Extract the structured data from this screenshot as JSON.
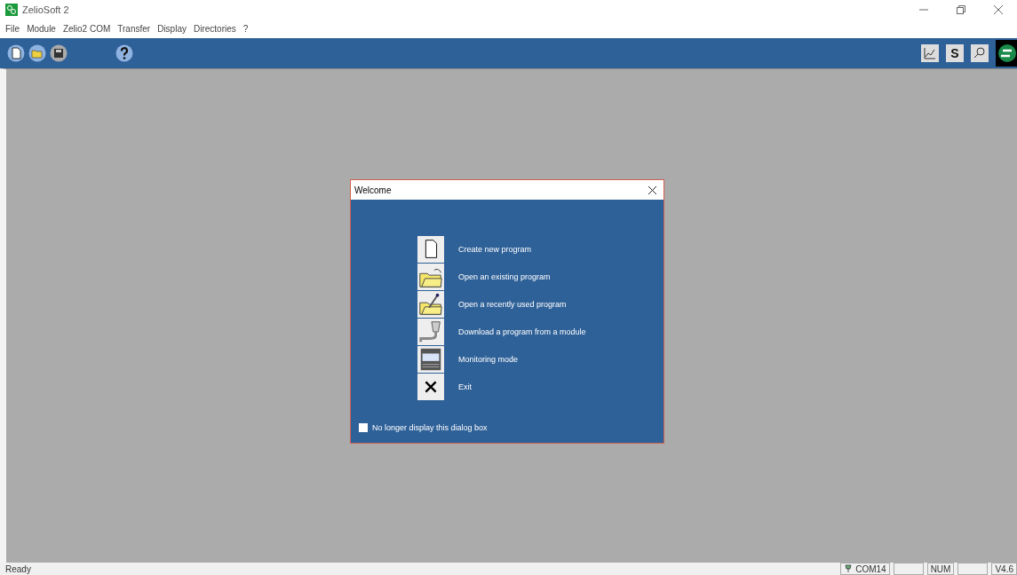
{
  "window": {
    "title": "ZelioSoft 2"
  },
  "toolbar": {
    "s_button": "S"
  },
  "menu": [
    "File",
    "Module",
    "Zelio2 COM",
    "Transfer",
    "Display",
    "Directories",
    "?"
  ],
  "dialog": {
    "title": "Welcome",
    "items": [
      {
        "label": "Create new program"
      },
      {
        "label": "Open an existing program"
      },
      {
        "label": "Open a recently used program"
      },
      {
        "label": "Download a program from a module"
      },
      {
        "label": "Monitoring mode"
      },
      {
        "label": "Exit"
      }
    ],
    "checkbox": {
      "label": "No longer display this dialog box",
      "checked": false
    }
  },
  "status_bar": {
    "text": "Ready",
    "port": "COM14",
    "num": "NUM",
    "version": "V4.6"
  }
}
